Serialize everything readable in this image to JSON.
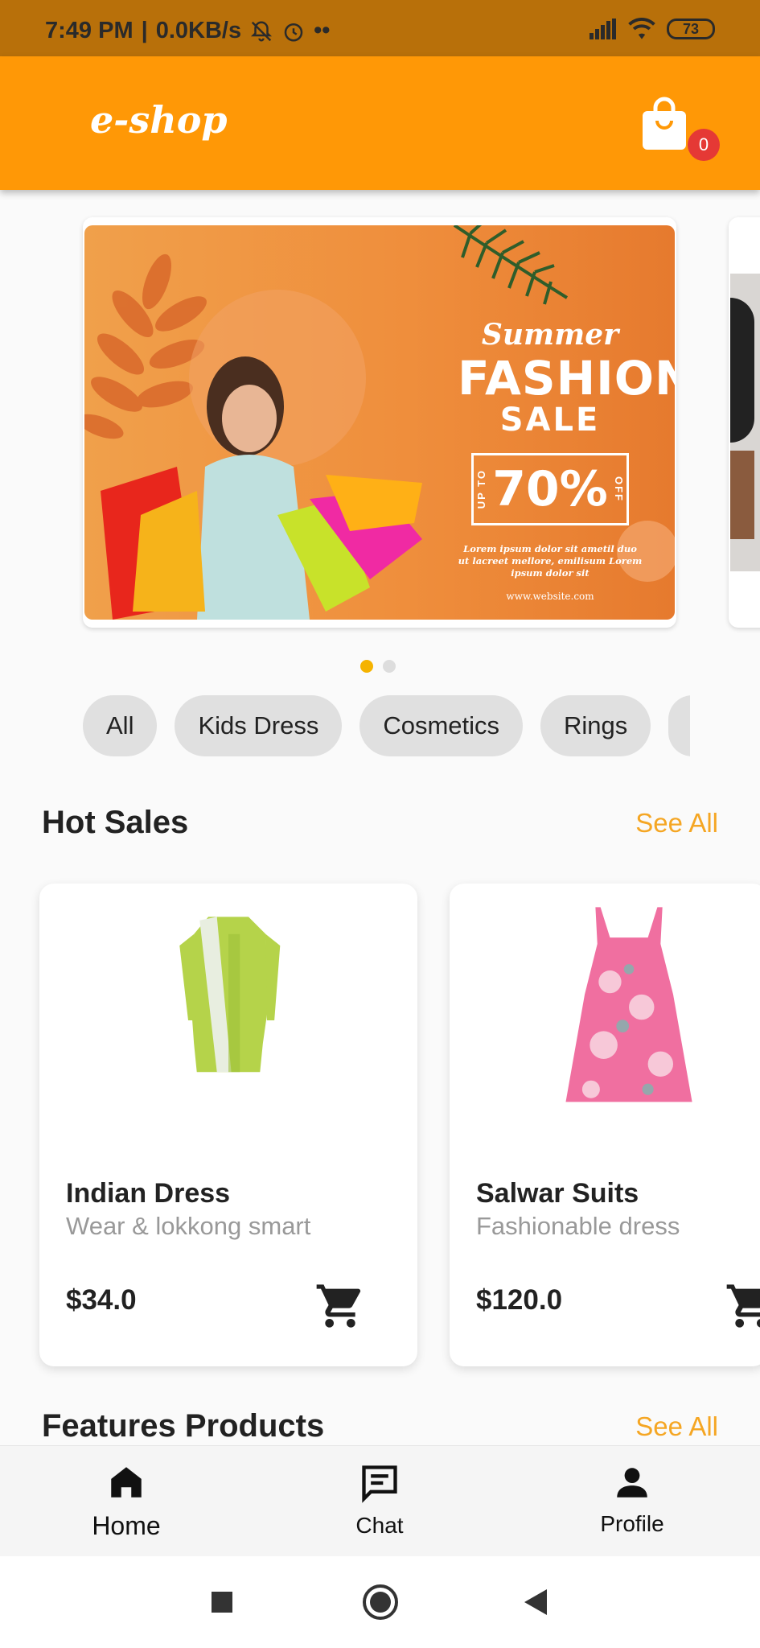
{
  "status_bar": {
    "time": "7:49 PM",
    "network_speed": "0.0KB/s",
    "dots": "••",
    "battery": "73"
  },
  "app_bar": {
    "logo": "e-shop",
    "cart_count": "0",
    "cart_icon": "shopping-bag-icon"
  },
  "banner": {
    "summer": "Summer",
    "fashion": "FASHION",
    "sale": "SALE",
    "up_to": "UP TO",
    "percent": "70%",
    "off": "OFF",
    "lorem": "Lorem ipsum dolor sit ametil duo ut lacreet mellore, emilisum Lorem ipsum dolor sit",
    "website": "www.website.com",
    "page_index": 0,
    "page_count": 2
  },
  "categories": [
    "All",
    "Kids Dress",
    "Cosmetics",
    "Rings"
  ],
  "hot_sales": {
    "title": "Hot Sales",
    "see_all": "See All",
    "products": [
      {
        "name": "Indian Dress",
        "desc": "Wear & lokkong smart",
        "price": "$34.0"
      },
      {
        "name": "Salwar Suits",
        "desc": "Fashionable dress",
        "price": "$120.0"
      }
    ]
  },
  "features": {
    "title": "Features Products",
    "see_all": "See All"
  },
  "bottom_nav": {
    "home": "Home",
    "chat": "Chat",
    "profile": "Profile"
  },
  "colors": {
    "accent": "#ff9806",
    "status_bar": "#b8700a",
    "see_all": "#f5a623",
    "badge": "#e53935"
  }
}
